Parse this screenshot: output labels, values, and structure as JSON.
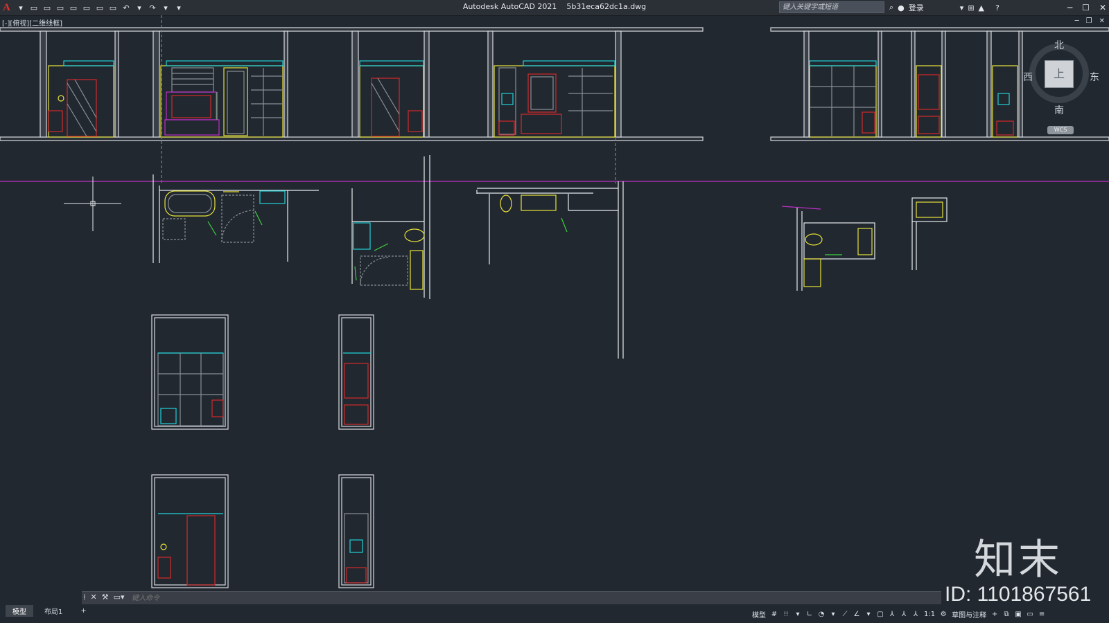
{
  "window": {
    "title": "Autodesk AutoCAD 2021",
    "filename": "5b31eca62dc1a.dwg",
    "search_placeholder": "键入关键字或短语",
    "login": "登录"
  },
  "toolbar": {
    "logo": "A",
    "new": "▭",
    "open": "▭",
    "save": "▭",
    "saveas": "▭",
    "plot": "▭",
    "undo": "↶",
    "redo": "↷"
  },
  "viewport": {
    "label": "[-][俯视][二维线框]"
  },
  "viewcube": {
    "north": "北",
    "south": "南",
    "east": "东",
    "west": "西",
    "face": "上",
    "wcs": "WCS"
  },
  "command": {
    "placeholder": "键入命令"
  },
  "layout_tabs": [
    "模型",
    "布局1",
    "+"
  ],
  "statusbar": {
    "model": "模型",
    "scale": "1:1",
    "workspace": "草图与注释"
  },
  "watermark": {
    "logo": "知末",
    "id": "ID: 1101867561"
  },
  "colors": {
    "background": "#212830",
    "cyan": "#1fd3d8",
    "yellow": "#e8e23a",
    "red": "#d42a2a",
    "magenta": "#c030c8",
    "green": "#3fd23f",
    "white": "#e8ecef"
  }
}
